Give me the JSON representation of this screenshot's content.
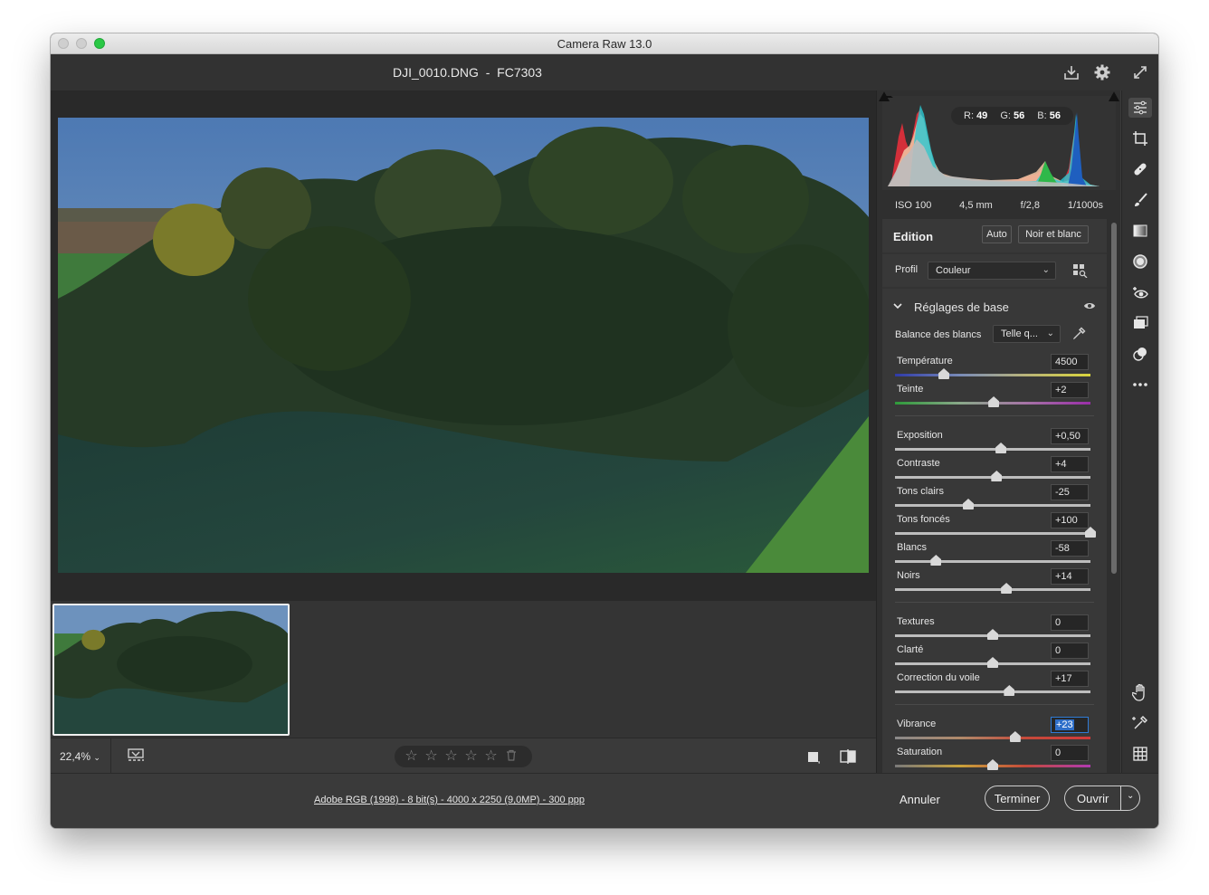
{
  "window": {
    "title": "Camera Raw 13.0"
  },
  "header": {
    "filename": "DJI_0010.DNG  -  FC7303"
  },
  "bottombar": {
    "zoom": "22,4%",
    "stars": [
      "☆",
      "☆",
      "☆",
      "☆",
      "☆"
    ]
  },
  "footer": {
    "file_info": "Adobe RGB (1998) - 8 bit(s) - 4000 x 2250 (9,0MP) - 300 ppp",
    "cancel_label": "Annuler",
    "done_label": "Terminer",
    "open_label": "Ouvrir"
  },
  "histogram": {
    "r_label": "R:",
    "r": "49",
    "g_label": "G:",
    "g": "56",
    "b_label": "B:",
    "b": "56"
  },
  "exif": {
    "iso": "ISO 100",
    "focal": "4,5 mm",
    "aperture": "f/2,8",
    "shutter": "1/1000s"
  },
  "edit": {
    "title": "Edition",
    "auto_label": "Auto",
    "bw_label": "Noir et blanc",
    "profile_label": "Profil",
    "profile_value": "Couleur",
    "basic_title": "Réglages de base",
    "wb_label": "Balance des blancs",
    "wb_value": "Telle q..."
  },
  "sliders": [
    {
      "label": "Température",
      "value": "4500",
      "pos": 0.25,
      "gradient": "temp"
    },
    {
      "label": "Teinte",
      "value": "+2",
      "pos": 0.505,
      "gradient": "tint"
    },
    {
      "label": "Exposition",
      "value": "+0,50",
      "pos": 0.542
    },
    {
      "label": "Contraste",
      "value": "+4",
      "pos": 0.52
    },
    {
      "label": "Tons clairs",
      "value": "-25",
      "pos": 0.375
    },
    {
      "label": "Tons foncés",
      "value": "+100",
      "pos": 1.0
    },
    {
      "label": "Blancs",
      "value": "-58",
      "pos": 0.21
    },
    {
      "label": "Noirs",
      "value": "+14",
      "pos": 0.57
    },
    {
      "label": "Textures",
      "value": "0",
      "pos": 0.5
    },
    {
      "label": "Clarté",
      "value": "0",
      "pos": 0.5
    },
    {
      "label": "Correction du voile",
      "value": "+17",
      "pos": 0.585
    },
    {
      "label": "Vibrance",
      "value": "+23",
      "pos": 0.615,
      "gradient": "vib",
      "selected": true
    },
    {
      "label": "Saturation",
      "value": "0",
      "pos": 0.5,
      "gradient": "sat"
    }
  ],
  "tools": [
    "sliders-icon",
    "crop-icon",
    "healing-icon",
    "brush-icon",
    "gradient-icon",
    "radial-filter-icon",
    "redeye-icon",
    "snapshots-icon",
    "presets-icon",
    "more-icon"
  ],
  "bottom_tools": [
    "hand-icon",
    "color-sampler-icon",
    "grid-icon"
  ]
}
